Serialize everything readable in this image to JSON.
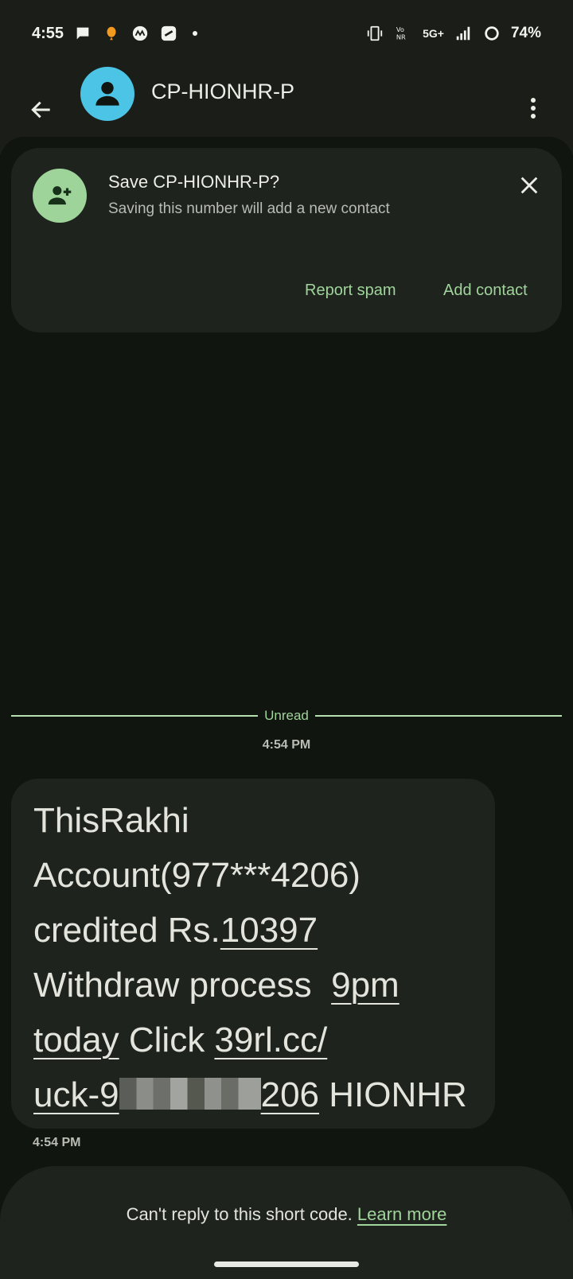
{
  "status_bar": {
    "time": "4:55",
    "network": "5G+",
    "battery": "74%"
  },
  "app_bar": {
    "contact_name": "CP-HIONHR-P"
  },
  "save_card": {
    "title": "Save CP-HIONHR-P?",
    "subtitle": "Saving this number will add a new contact",
    "report_spam": "Report spam",
    "add_contact": "Add contact"
  },
  "conversation": {
    "unread_label": "Unread",
    "date_time": "4:54 PM",
    "message": {
      "line1": "ThisRakhi",
      "line2": "Account(977***4206)",
      "line3_plain": "credited Rs.",
      "line3_link": "10397",
      "line4_plain": "Withdraw process  ",
      "line4_link": "9pm",
      "line5_link": "today",
      "line5_plain": " Click ",
      "line5_link2": "39rl.cc/",
      "line6_link_start": "uck-9",
      "line6_link_end": "206",
      "line6_plain": " HIONHR",
      "time": "4:54 PM"
    }
  },
  "bottom_bar": {
    "text": "Can't reply to this short code. ",
    "learn_more": "Learn more"
  },
  "colors": {
    "accent": "#9fd49b",
    "avatar": "#4cc4e5",
    "card": "#1f231e",
    "background": "#111510"
  }
}
